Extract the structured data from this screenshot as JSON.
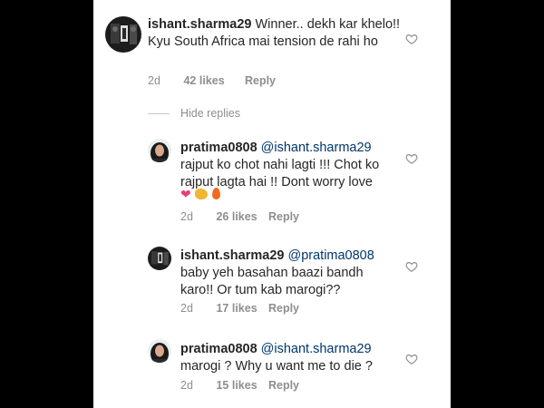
{
  "comments": [
    {
      "username": "ishant.sharma29",
      "mention": "",
      "text": "Winner.. dekh kar khelo!! Kyu South Africa mai tension de rahi ho",
      "age": "2d",
      "likes": "42 likes",
      "reply": "Reply"
    }
  ],
  "hide_replies": "Hide replies",
  "replies": [
    {
      "username": "pratima0808",
      "mention": "@ishant.sharma29",
      "text": "rajput ko chot nahi lagti !!! Chot ko rajput lagta hai !! Dont worry love",
      "emojis": "❤💪🔥",
      "age": "2d",
      "likes": "26 likes",
      "reply": "Reply"
    },
    {
      "username": "ishant.sharma29",
      "mention": "@pratima0808",
      "text": "baby yeh basahan baazi bandh karo!! Or tum kab marogi??",
      "age": "2d",
      "likes": "17 likes",
      "reply": "Reply"
    },
    {
      "username": "pratima0808",
      "mention": "@ishant.sharma29",
      "text": "marogi ? Why u want me to die ?",
      "age": "2d",
      "likes": "15 likes",
      "reply": "Reply"
    }
  ],
  "colors": {
    "text": "#262626",
    "mention": "#00376b",
    "secondary": "#8e8e8e",
    "emoji_heart": "#e8416f",
    "emoji_muscle": "#f2b632",
    "emoji_fire": "#f26a1b"
  },
  "icons": {
    "like": "heart-outline-icon",
    "avatar_ishant": "avatar-dark-photo",
    "avatar_pratima": "avatar-woman-photo"
  }
}
